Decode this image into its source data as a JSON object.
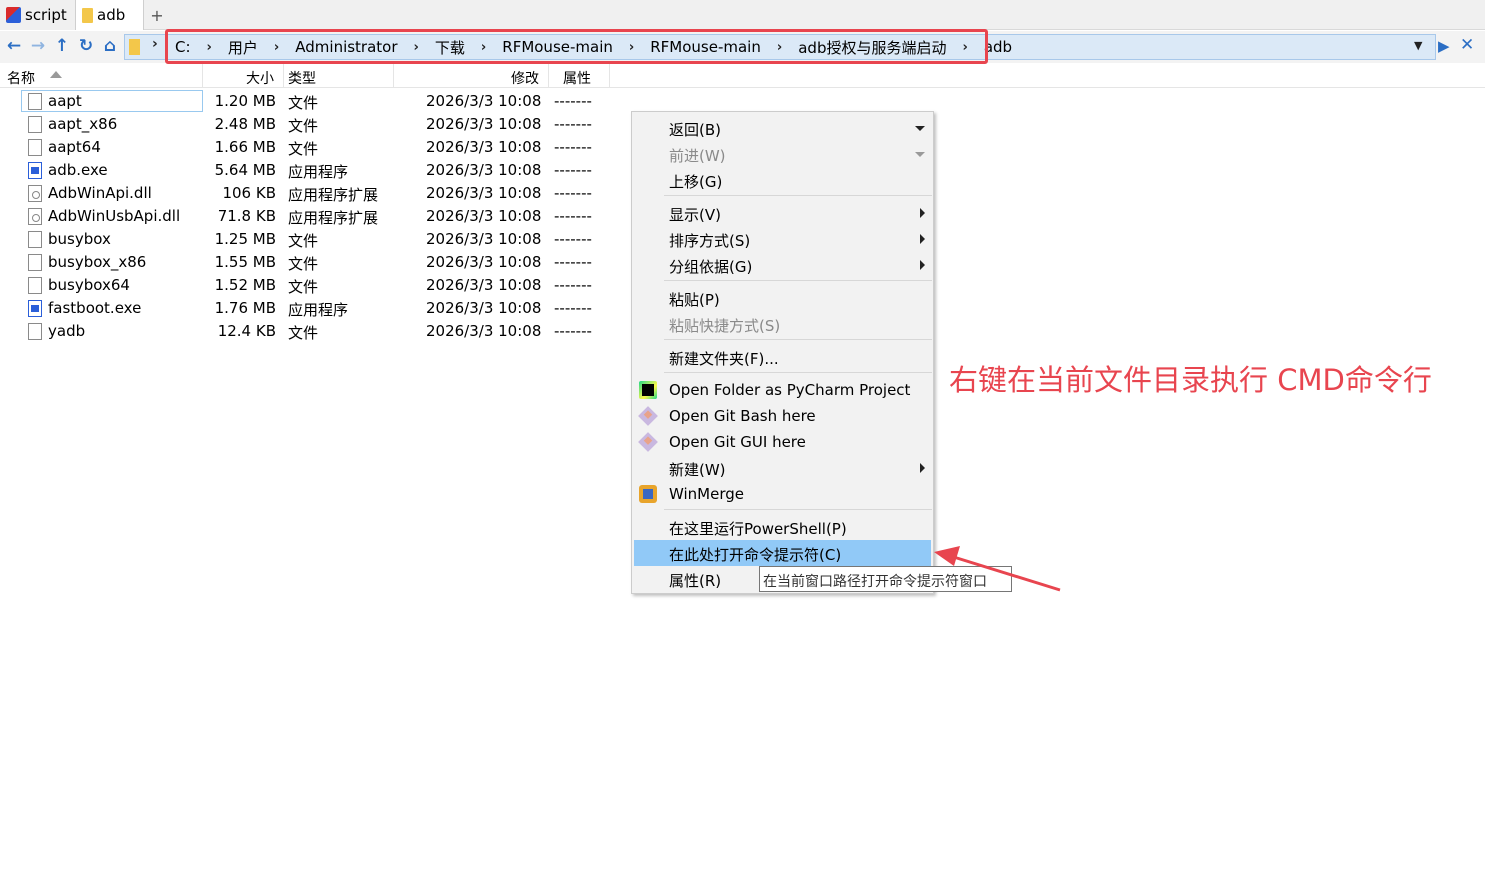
{
  "tabs": [
    {
      "label": "script"
    },
    {
      "label": "adb"
    }
  ],
  "tab_add": "+",
  "address": {
    "crumbs": [
      "C:",
      "用户",
      "Administrator",
      "下载",
      "RFMouse-main",
      "RFMouse-main",
      "adb授权与服务端启动",
      "adb"
    ]
  },
  "columns": {
    "name": "名称",
    "size": "大小",
    "type": "类型",
    "modified": "修改",
    "attributes": "属性"
  },
  "files": [
    {
      "name": "aapt",
      "size": "1.20 MB",
      "type": "文件",
      "date": "2026/3/3  10:08",
      "attr": "-------",
      "icon": "file-icon"
    },
    {
      "name": "aapt_x86",
      "size": "2.48 MB",
      "type": "文件",
      "date": "2026/3/3  10:08",
      "attr": "-------",
      "icon": "file-icon"
    },
    {
      "name": "aapt64",
      "size": "1.66 MB",
      "type": "文件",
      "date": "2026/3/3  10:08",
      "attr": "-------",
      "icon": "file-icon"
    },
    {
      "name": "adb.exe",
      "size": "5.64 MB",
      "type": "应用程序",
      "date": "2026/3/3  10:08",
      "attr": "-------",
      "icon": "exe-icon"
    },
    {
      "name": "AdbWinApi.dll",
      "size": "106 KB",
      "type": "应用程序扩展",
      "date": "2026/3/3  10:08",
      "attr": "-------",
      "icon": "dll-icon"
    },
    {
      "name": "AdbWinUsbApi.dll",
      "size": "71.8 KB",
      "type": "应用程序扩展",
      "date": "2026/3/3  10:08",
      "attr": "-------",
      "icon": "dll-icon"
    },
    {
      "name": "busybox",
      "size": "1.25 MB",
      "type": "文件",
      "date": "2026/3/3  10:08",
      "attr": "-------",
      "icon": "file-icon"
    },
    {
      "name": "busybox_x86",
      "size": "1.55 MB",
      "type": "文件",
      "date": "2026/3/3  10:08",
      "attr": "-------",
      "icon": "file-icon"
    },
    {
      "name": "busybox64",
      "size": "1.52 MB",
      "type": "文件",
      "date": "2026/3/3  10:08",
      "attr": "-------",
      "icon": "file-icon"
    },
    {
      "name": "fastboot.exe",
      "size": "1.76 MB",
      "type": "应用程序",
      "date": "2026/3/3  10:08",
      "attr": "-------",
      "icon": "exe-icon"
    },
    {
      "name": "yadb",
      "size": "12.4 KB",
      "type": "文件",
      "date": "2026/3/3  10:08",
      "attr": "-------",
      "icon": "file-icon"
    }
  ],
  "context_menu": {
    "back": "返回(B)",
    "forward": "前进(W)",
    "up": "上移(G)",
    "view": "显示(V)",
    "sort_by": "排序方式(S)",
    "group_by": "分组依据(G)",
    "paste": "粘贴(P)",
    "paste_shortcut": "粘贴快捷方式(S)",
    "new_folder": "新建文件夹(F)...",
    "pycharm": "Open Folder as PyCharm Project",
    "git_bash": "Open Git Bash here",
    "git_gui": "Open Git GUI here",
    "new": "新建(W)",
    "winmerge": "WinMerge",
    "powershell": "在这里运行PowerShell(P)",
    "cmd_here": "在此处打开命令提示符(C)",
    "properties": "属性(R)"
  },
  "tooltip": "在当前窗口路径打开命令提示符窗口",
  "annotation": "右键在当前文件目录执行 CMD命令行",
  "colors": {
    "annotation": "#e8454f",
    "highlight": "#91c9f7",
    "accent": "#2b6ec4"
  }
}
